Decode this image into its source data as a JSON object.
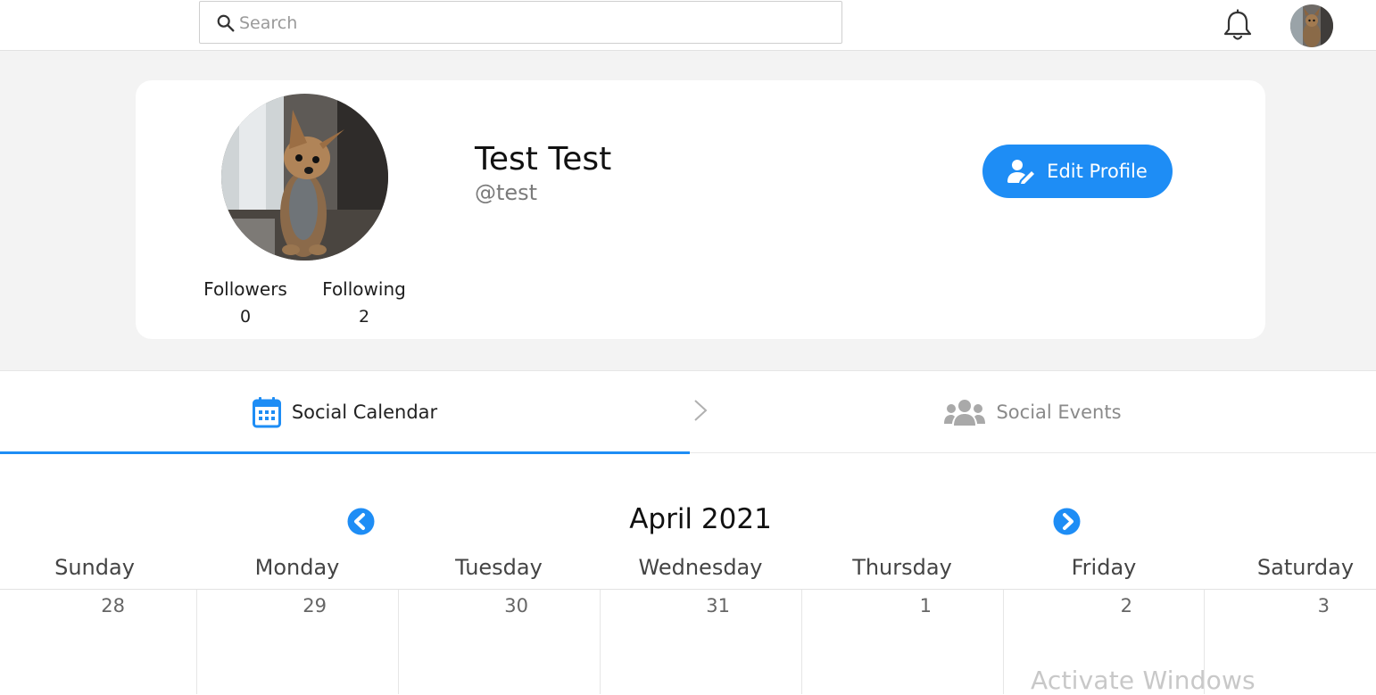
{
  "search": {
    "placeholder": "Search"
  },
  "profile": {
    "name": "Test Test",
    "handle": "@test",
    "followers_label": "Followers",
    "followers_count": "0",
    "following_label": "Following",
    "following_count": "2",
    "edit_button_label": "Edit Profile"
  },
  "tabs": [
    {
      "label": "Social Calendar",
      "icon": "calendar-icon",
      "active": true
    },
    {
      "label": "Social Events",
      "icon": "users-icon",
      "active": false
    }
  ],
  "calendar": {
    "month_label": "April 2021",
    "weekdays": [
      "Sunday",
      "Monday",
      "Tuesday",
      "Wednesday",
      "Thursday",
      "Friday",
      "Saturday"
    ],
    "first_week": [
      "28",
      "29",
      "30",
      "31",
      "1",
      "2",
      "3"
    ]
  },
  "watermark": "Activate Windows",
  "colors": {
    "accent": "#1e8df5",
    "page_bg": "#f3f3f3",
    "muted": "#8a8a8a"
  }
}
